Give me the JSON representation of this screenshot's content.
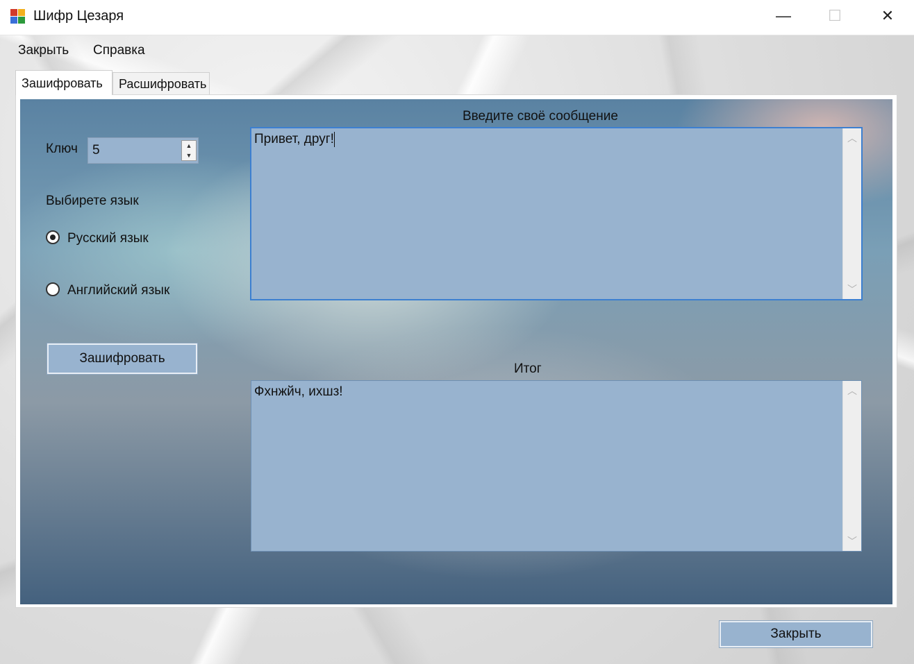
{
  "window": {
    "title": "Шифр Цезаря",
    "minimize_icon": "minimize-icon",
    "maximize_icon": "maximize-icon",
    "close_icon": "close-icon",
    "minimize_glyph": "—",
    "maximize_glyph": "☐",
    "close_glyph": "✕"
  },
  "menu": {
    "items": [
      {
        "label": "Закрыть"
      },
      {
        "label": "Справка"
      }
    ]
  },
  "tabs": [
    {
      "label": "Зашифровать",
      "active": true
    },
    {
      "label": "Расшифровать",
      "active": false
    }
  ],
  "encrypt": {
    "key_label": "Ключ",
    "key_value": "5",
    "language_label": "Выбирете язык",
    "languages": [
      {
        "label": "Русский язык",
        "selected": true
      },
      {
        "label": "Английский язык",
        "selected": false
      }
    ],
    "encrypt_button": "Зашифровать",
    "input_label": "Введите своё сообщение",
    "input_text": "Привет, друг!",
    "output_label": "Итог",
    "output_text": "Фхнжйч, ихшз!"
  },
  "footer": {
    "close_button": "Закрыть"
  },
  "colors": {
    "control_fill": "#98b3cf",
    "focus_border": "#3c7fd0"
  }
}
